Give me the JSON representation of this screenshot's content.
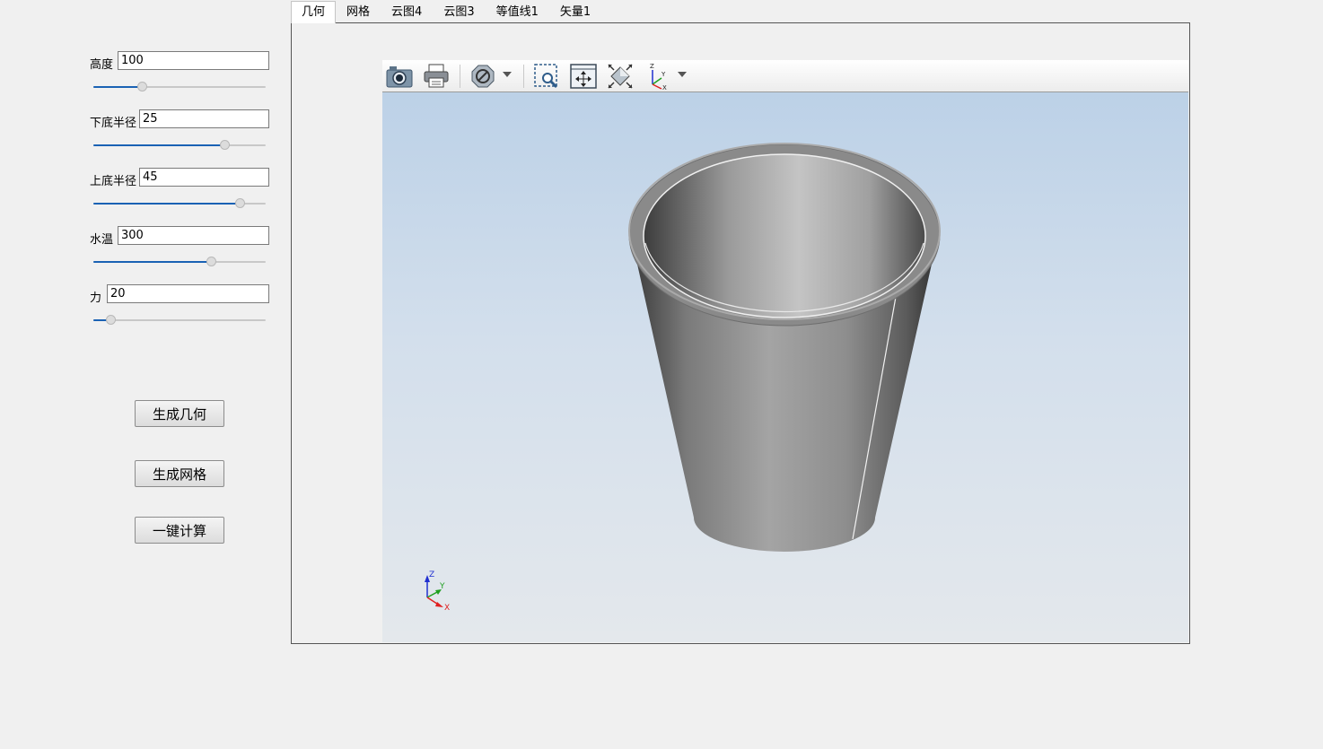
{
  "params": [
    {
      "label": "高度",
      "value": "100",
      "slider_fraction": 0.28
    },
    {
      "label": "下底半径",
      "value": "25",
      "slider_fraction": 0.76
    },
    {
      "label": "上底半径",
      "value": "45",
      "slider_fraction": 0.85
    },
    {
      "label": "水温",
      "value": "300",
      "slider_fraction": 0.68
    },
    {
      "label": "力",
      "value": "20",
      "slider_fraction": 0.1
    }
  ],
  "buttons": {
    "generate_geometry": "生成几何",
    "generate_mesh": "生成网格",
    "one_click_compute": "一键计算"
  },
  "tabs": [
    "几何",
    "网格",
    "云图4",
    "云图3",
    "等值线1",
    "矢量1"
  ],
  "active_tab": 0,
  "toolbar": {
    "icons": [
      "camera-icon",
      "print-icon",
      "hide-icon",
      "zoom-box-icon",
      "pan-icon",
      "fit-view-icon",
      "axes-icon"
    ]
  },
  "axis_triad": {
    "x": "X",
    "y": "Y",
    "z": "Z"
  },
  "colors": {
    "slider_fill": "#1a62b4",
    "scene_top": "#bcd1e7",
    "scene_bottom": "#e4e8ec",
    "axis_x": "#e02020",
    "axis_y": "#20a020",
    "axis_z": "#2030d0"
  }
}
